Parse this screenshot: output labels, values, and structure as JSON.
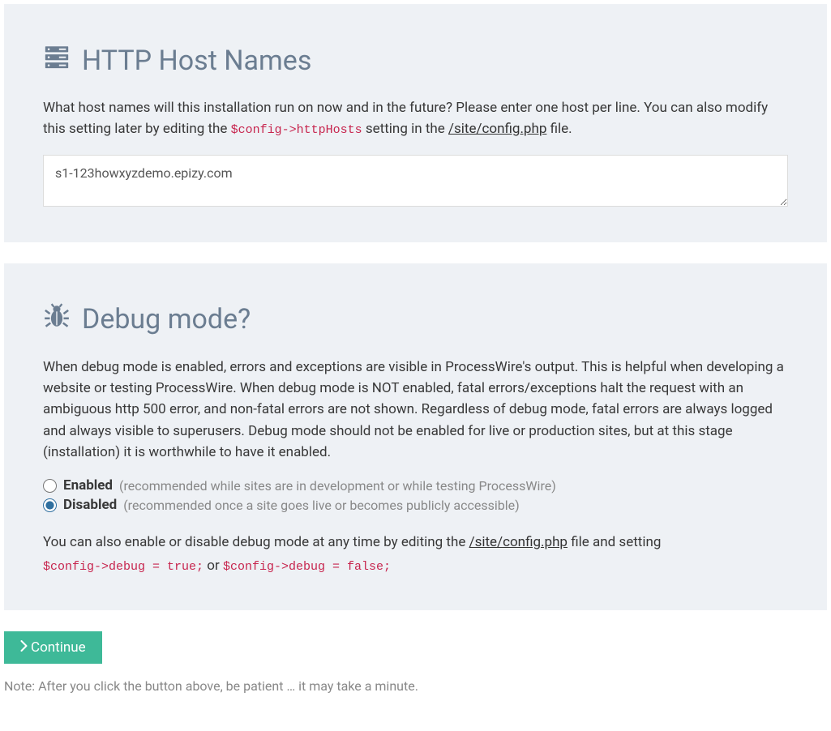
{
  "hostnames": {
    "title": "HTTP Host Names",
    "desc_part1": "What host names will this installation run on now and in the future? Please enter one host per line. You can also modify this setting later by editing the ",
    "code1": "$config->httpHosts",
    "desc_part2": " setting in the ",
    "configfile": "/site/config.php",
    "desc_part3": " file.",
    "value": "s1-123howxyzdemo.epizy.com"
  },
  "debug": {
    "title": "Debug mode?",
    "description": "When debug mode is enabled, errors and exceptions are visible in ProcessWire's output. This is helpful when developing a website or testing ProcessWire. When debug mode is NOT enabled, fatal errors/exceptions halt the request with an ambiguous http 500 error, and non-fatal errors are not shown. Regardless of debug mode, fatal errors are always logged and always visible to superusers. Debug mode should not be enabled for live or production sites, but at this stage (installation) it is worthwhile to have it enabled.",
    "enabled_label": "Enabled",
    "enabled_hint": "(recommended while sites are in development or while testing ProcessWire)",
    "disabled_label": "Disabled",
    "disabled_hint": "(recommended once a site goes live or becomes publicly accessible)",
    "footer_part1": "You can also enable or disable debug mode at any time by editing the ",
    "footer_configfile": "/site/config.php",
    "footer_part2": " file and setting ",
    "code_true": "$config->debug = true;",
    "footer_or": " or ",
    "code_false": "$config->debug = false;"
  },
  "button": {
    "label": "Continue"
  },
  "note": "Note: After you click the button above, be patient … it may take a minute."
}
